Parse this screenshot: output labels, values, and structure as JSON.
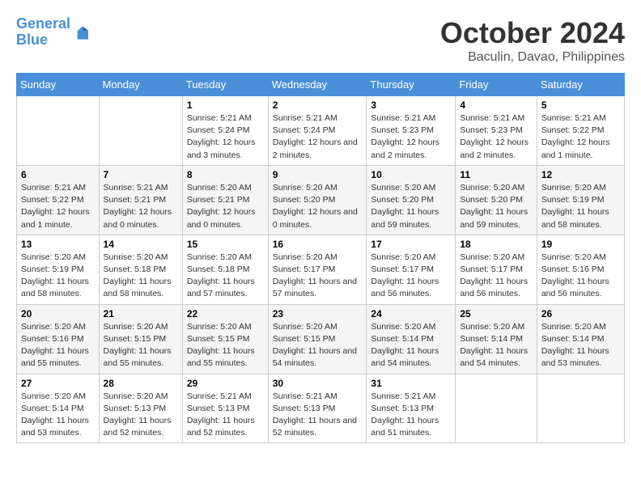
{
  "header": {
    "logo_line1": "General",
    "logo_line2": "Blue",
    "month": "October 2024",
    "location": "Baculin, Davao, Philippines"
  },
  "weekdays": [
    "Sunday",
    "Monday",
    "Tuesday",
    "Wednesday",
    "Thursday",
    "Friday",
    "Saturday"
  ],
  "weeks": [
    [
      {
        "day": "",
        "detail": ""
      },
      {
        "day": "",
        "detail": ""
      },
      {
        "day": "1",
        "detail": "Sunrise: 5:21 AM\nSunset: 5:24 PM\nDaylight: 12 hours\nand 3 minutes."
      },
      {
        "day": "2",
        "detail": "Sunrise: 5:21 AM\nSunset: 5:24 PM\nDaylight: 12 hours\nand 2 minutes."
      },
      {
        "day": "3",
        "detail": "Sunrise: 5:21 AM\nSunset: 5:23 PM\nDaylight: 12 hours\nand 2 minutes."
      },
      {
        "day": "4",
        "detail": "Sunrise: 5:21 AM\nSunset: 5:23 PM\nDaylight: 12 hours\nand 2 minutes."
      },
      {
        "day": "5",
        "detail": "Sunrise: 5:21 AM\nSunset: 5:22 PM\nDaylight: 12 hours\nand 1 minute."
      }
    ],
    [
      {
        "day": "6",
        "detail": "Sunrise: 5:21 AM\nSunset: 5:22 PM\nDaylight: 12 hours\nand 1 minute."
      },
      {
        "day": "7",
        "detail": "Sunrise: 5:21 AM\nSunset: 5:21 PM\nDaylight: 12 hours\nand 0 minutes."
      },
      {
        "day": "8",
        "detail": "Sunrise: 5:20 AM\nSunset: 5:21 PM\nDaylight: 12 hours\nand 0 minutes."
      },
      {
        "day": "9",
        "detail": "Sunrise: 5:20 AM\nSunset: 5:20 PM\nDaylight: 12 hours\nand 0 minutes."
      },
      {
        "day": "10",
        "detail": "Sunrise: 5:20 AM\nSunset: 5:20 PM\nDaylight: 11 hours\nand 59 minutes."
      },
      {
        "day": "11",
        "detail": "Sunrise: 5:20 AM\nSunset: 5:20 PM\nDaylight: 11 hours\nand 59 minutes."
      },
      {
        "day": "12",
        "detail": "Sunrise: 5:20 AM\nSunset: 5:19 PM\nDaylight: 11 hours\nand 58 minutes."
      }
    ],
    [
      {
        "day": "13",
        "detail": "Sunrise: 5:20 AM\nSunset: 5:19 PM\nDaylight: 11 hours\nand 58 minutes."
      },
      {
        "day": "14",
        "detail": "Sunrise: 5:20 AM\nSunset: 5:18 PM\nDaylight: 11 hours\nand 58 minutes."
      },
      {
        "day": "15",
        "detail": "Sunrise: 5:20 AM\nSunset: 5:18 PM\nDaylight: 11 hours\nand 57 minutes."
      },
      {
        "day": "16",
        "detail": "Sunrise: 5:20 AM\nSunset: 5:17 PM\nDaylight: 11 hours\nand 57 minutes."
      },
      {
        "day": "17",
        "detail": "Sunrise: 5:20 AM\nSunset: 5:17 PM\nDaylight: 11 hours\nand 56 minutes."
      },
      {
        "day": "18",
        "detail": "Sunrise: 5:20 AM\nSunset: 5:17 PM\nDaylight: 11 hours\nand 56 minutes."
      },
      {
        "day": "19",
        "detail": "Sunrise: 5:20 AM\nSunset: 5:16 PM\nDaylight: 11 hours\nand 56 minutes."
      }
    ],
    [
      {
        "day": "20",
        "detail": "Sunrise: 5:20 AM\nSunset: 5:16 PM\nDaylight: 11 hours\nand 55 minutes."
      },
      {
        "day": "21",
        "detail": "Sunrise: 5:20 AM\nSunset: 5:15 PM\nDaylight: 11 hours\nand 55 minutes."
      },
      {
        "day": "22",
        "detail": "Sunrise: 5:20 AM\nSunset: 5:15 PM\nDaylight: 11 hours\nand 55 minutes."
      },
      {
        "day": "23",
        "detail": "Sunrise: 5:20 AM\nSunset: 5:15 PM\nDaylight: 11 hours\nand 54 minutes."
      },
      {
        "day": "24",
        "detail": "Sunrise: 5:20 AM\nSunset: 5:14 PM\nDaylight: 11 hours\nand 54 minutes."
      },
      {
        "day": "25",
        "detail": "Sunrise: 5:20 AM\nSunset: 5:14 PM\nDaylight: 11 hours\nand 54 minutes."
      },
      {
        "day": "26",
        "detail": "Sunrise: 5:20 AM\nSunset: 5:14 PM\nDaylight: 11 hours\nand 53 minutes."
      }
    ],
    [
      {
        "day": "27",
        "detail": "Sunrise: 5:20 AM\nSunset: 5:14 PM\nDaylight: 11 hours\nand 53 minutes."
      },
      {
        "day": "28",
        "detail": "Sunrise: 5:20 AM\nSunset: 5:13 PM\nDaylight: 11 hours\nand 52 minutes."
      },
      {
        "day": "29",
        "detail": "Sunrise: 5:21 AM\nSunset: 5:13 PM\nDaylight: 11 hours\nand 52 minutes."
      },
      {
        "day": "30",
        "detail": "Sunrise: 5:21 AM\nSunset: 5:13 PM\nDaylight: 11 hours\nand 52 minutes."
      },
      {
        "day": "31",
        "detail": "Sunrise: 5:21 AM\nSunset: 5:13 PM\nDaylight: 11 hours\nand 51 minutes."
      },
      {
        "day": "",
        "detail": ""
      },
      {
        "day": "",
        "detail": ""
      }
    ]
  ]
}
